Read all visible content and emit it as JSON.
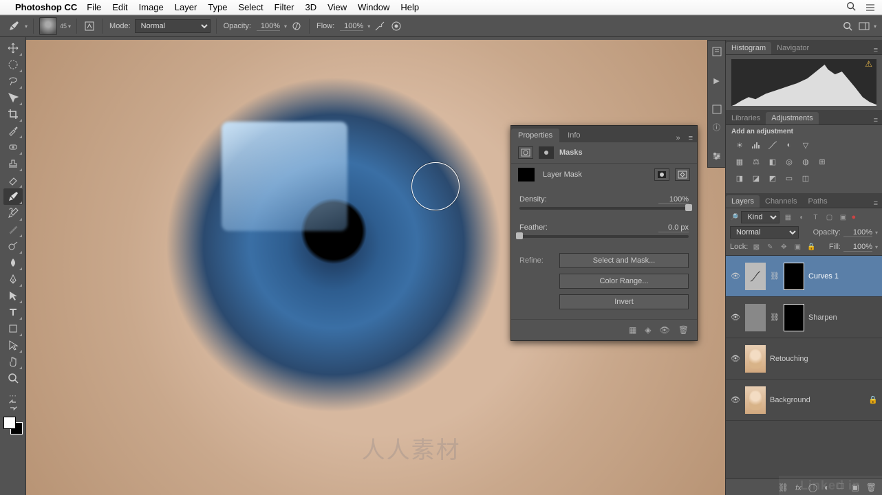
{
  "menubar": {
    "app": "Photoshop CC",
    "items": [
      "File",
      "Edit",
      "Image",
      "Layer",
      "Type",
      "Select",
      "Filter",
      "3D",
      "View",
      "Window",
      "Help"
    ]
  },
  "optionsBar": {
    "brushSize": "45",
    "modeLabel": "Mode:",
    "modeValue": "Normal",
    "opacityLabel": "Opacity:",
    "opacityValue": "100%",
    "flowLabel": "Flow:",
    "flowValue": "100%"
  },
  "propertiesPanel": {
    "tabs": [
      "Properties",
      "Info"
    ],
    "masksLabel": "Masks",
    "maskType": "Layer Mask",
    "density": {
      "label": "Density:",
      "value": "100%",
      "pos": 100
    },
    "feather": {
      "label": "Feather:",
      "value": "0.0 px",
      "pos": 0
    },
    "refineLabel": "Refine:",
    "buttons": [
      "Select and Mask...",
      "Color Range...",
      "Invert"
    ]
  },
  "rightDock": {
    "histogram": {
      "tabs": [
        "Histogram",
        "Navigator"
      ]
    },
    "libraries": {
      "tabs": [
        "Libraries",
        "Adjustments"
      ],
      "title": "Add an adjustment"
    },
    "layersPanel": {
      "tabs": [
        "Layers",
        "Channels",
        "Paths"
      ],
      "kindLabel": "Kind",
      "blendMode": "Normal",
      "opacityLabel": "Opacity:",
      "opacityValue": "100%",
      "fillLabel": "Fill:",
      "fillValue": "100%",
      "lockLabel": "Lock:",
      "layers": [
        {
          "name": "Curves 1",
          "type": "adjustment",
          "selected": true
        },
        {
          "name": "Sharpen",
          "type": "smart",
          "selected": false
        },
        {
          "name": "Retouching",
          "type": "pixel",
          "selected": false
        },
        {
          "name": "Background",
          "type": "pixel",
          "selected": false,
          "locked": true
        }
      ]
    }
  },
  "watermarkText": "人人素材",
  "linkedText": "Linked in"
}
